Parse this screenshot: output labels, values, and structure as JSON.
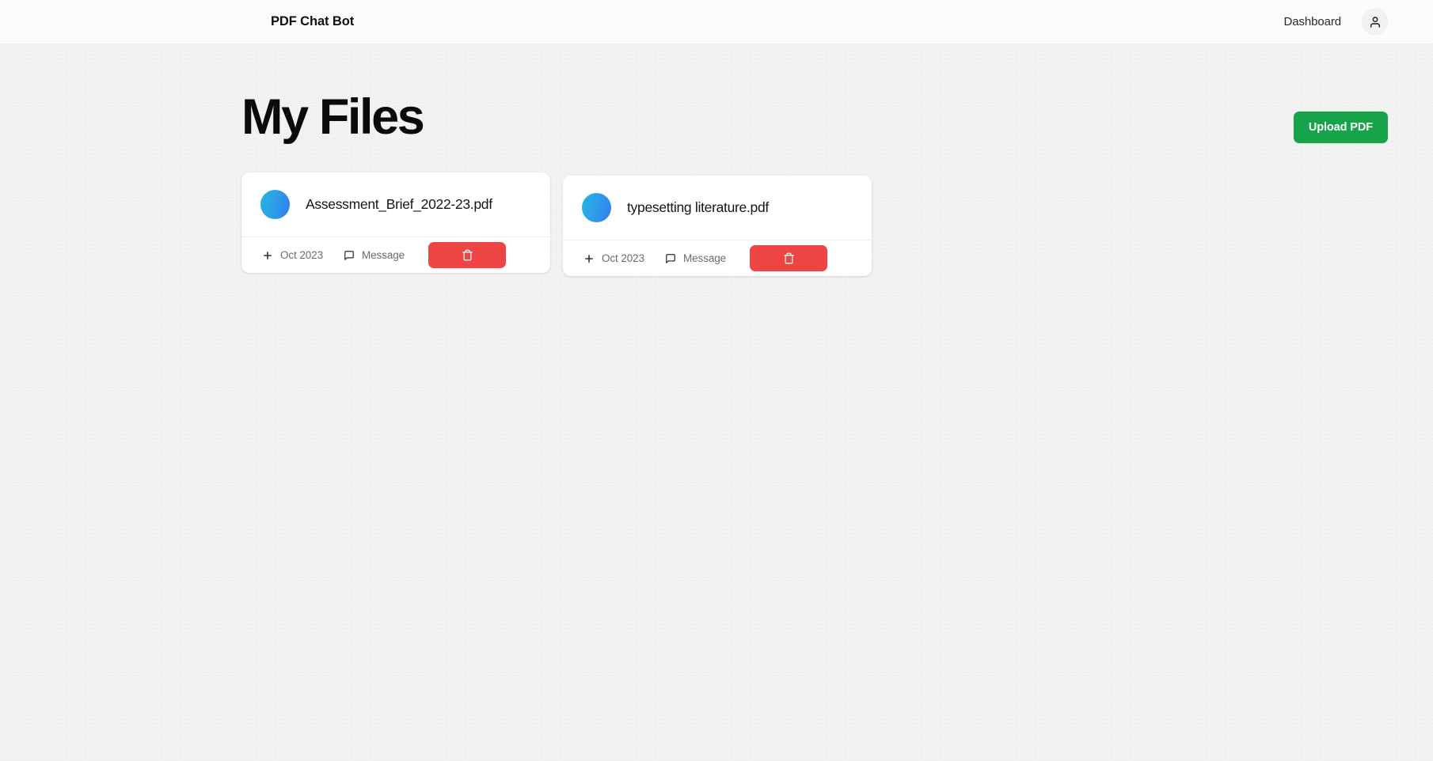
{
  "navbar": {
    "brand": "PDF Chat Bot",
    "dashboard_link": "Dashboard",
    "avatar_icon": "user-icon"
  },
  "main": {
    "title": "My Files",
    "upload_button": "Upload PDF",
    "upload_button_color": "#17a34a"
  },
  "files": [
    {
      "name": "Assessment_Brief_2022-23.pdf",
      "date": "Oct 2023",
      "message_label": "Message",
      "date_icon": "plus-icon",
      "message_icon": "message-icon",
      "delete_icon": "trash-icon",
      "delete_color": "#ef4444",
      "avatar_icon": "pdf-avatar-circle"
    },
    {
      "name": "typesetting literature.pdf",
      "date": "Oct 2023",
      "message_label": "Message",
      "date_icon": "plus-icon",
      "message_icon": "message-icon",
      "delete_icon": "trash-icon",
      "delete_color": "#ef4444",
      "avatar_icon": "pdf-avatar-circle"
    }
  ]
}
